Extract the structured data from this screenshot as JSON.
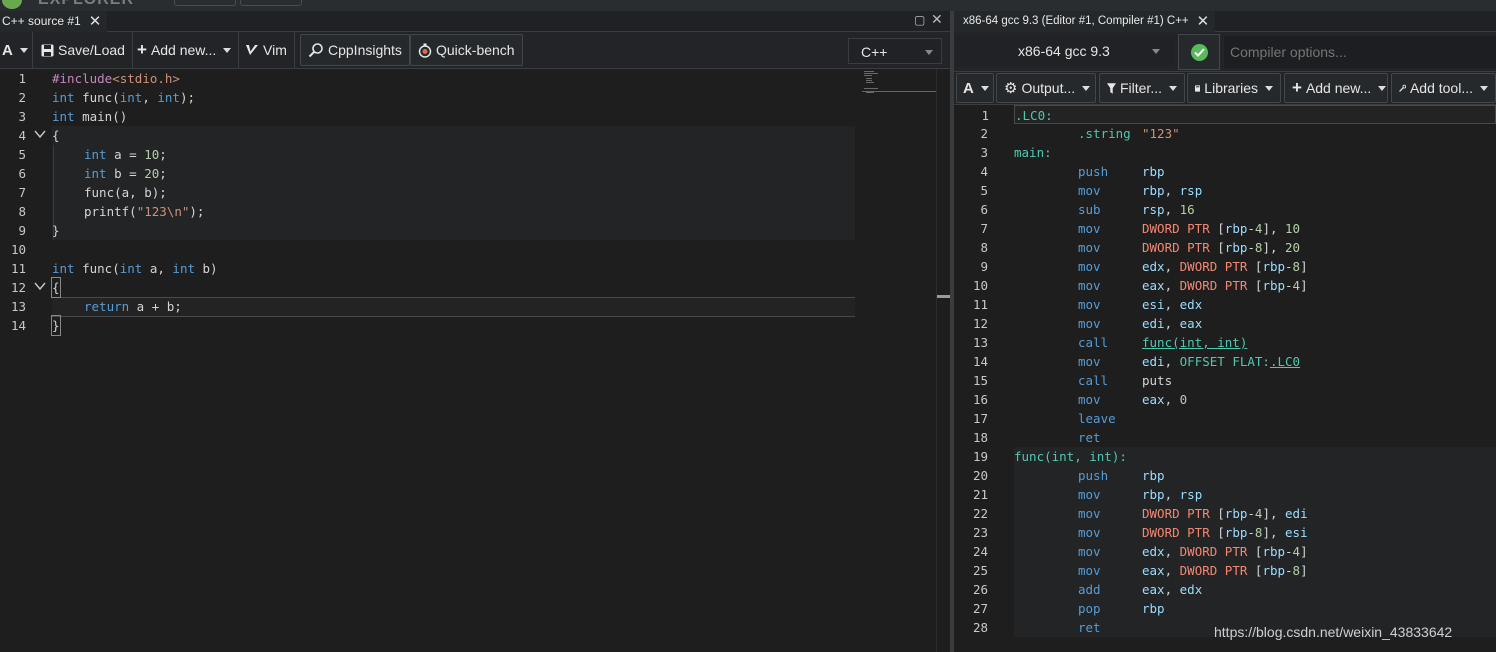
{
  "brand": {
    "logo_text": "EXPLORER"
  },
  "left": {
    "tab_label": "C++ source #1",
    "toolbar": {
      "font_btn": "A",
      "save_load": "Save/Load",
      "add_new": "Add new...",
      "vim": "Vim",
      "cppinsights": "CppInsights",
      "quick_bench": "Quick-bench"
    },
    "language": "C++",
    "code": [
      {
        "n": "1",
        "fold": false
      },
      {
        "n": "2",
        "fold": false
      },
      {
        "n": "3",
        "fold": false
      },
      {
        "n": "4",
        "fold": true
      },
      {
        "n": "5",
        "fold": false
      },
      {
        "n": "6",
        "fold": false
      },
      {
        "n": "7",
        "fold": false
      },
      {
        "n": "8",
        "fold": false
      },
      {
        "n": "9",
        "fold": false
      },
      {
        "n": "10",
        "fold": false
      },
      {
        "n": "11",
        "fold": false
      },
      {
        "n": "12",
        "fold": true
      },
      {
        "n": "13",
        "fold": false
      },
      {
        "n": "14",
        "fold": false
      }
    ],
    "source": {
      "l1a": "#include",
      "l1b": "<stdio.h>",
      "l2a": "int",
      "l2b": " func(",
      "l2c": "int",
      ", ": "",
      "l2d": ", ",
      "l2e": "int",
      "l2f": ");",
      "l3a": "int",
      "l3b": " main()",
      "l4": "{",
      "l5a": "int",
      "l5b": " a = ",
      "l5c": "10",
      "l5d": ";",
      "l6a": "int",
      "l6b": " b = ",
      "l6c": "20",
      "l6d": ";",
      "l7": "func(a, b);",
      "l8a": "printf(",
      "l8b": "\"123\\n\"",
      "l8c": ");",
      "l9": "}",
      "l11a": "int",
      "l11b": " func(",
      "l11c": "int",
      "l11d": " a, ",
      "l11e": "int",
      "l11f": " b)",
      "l12": "{",
      "l13a": "return",
      "l13b": " a + b;",
      "l14": "}"
    }
  },
  "right": {
    "tab_label": "x86-64 gcc 9.3 (Editor #1, Compiler #1) C++",
    "compiler": "x86-64 gcc 9.3",
    "compiler_options_placeholder": "Compiler options...",
    "toolbar": {
      "font_btn": "A",
      "output": "Output...",
      "filter": "Filter...",
      "libraries": "Libraries",
      "add_new": "Add new...",
      "add_tool": "Add tool..."
    },
    "asm": [
      {
        "n": "1",
        "label": ".LC0:"
      },
      {
        "n": "2",
        "ins": ".string",
        "arg": "\"123\""
      },
      {
        "n": "3",
        "label": "main:"
      },
      {
        "n": "4",
        "ins": "push",
        "arg": "rbp"
      },
      {
        "n": "5",
        "ins": "mov",
        "arg": "rbp, rsp"
      },
      {
        "n": "6",
        "ins": "sub",
        "arg": "rsp, 16"
      },
      {
        "n": "7",
        "ins": "mov",
        "arg": "DWORD PTR [rbp-4], 10"
      },
      {
        "n": "8",
        "ins": "mov",
        "arg": "DWORD PTR [rbp-8], 20"
      },
      {
        "n": "9",
        "ins": "mov",
        "arg": "edx, DWORD PTR [rbp-8]"
      },
      {
        "n": "10",
        "ins": "mov",
        "arg": "eax, DWORD PTR [rbp-4]"
      },
      {
        "n": "11",
        "ins": "mov",
        "arg": "esi, edx"
      },
      {
        "n": "12",
        "ins": "mov",
        "arg": "edi, eax"
      },
      {
        "n": "13",
        "ins": "call",
        "arg": "func(int, int)"
      },
      {
        "n": "14",
        "ins": "mov",
        "arg": "edi, OFFSET FLAT:.LC0"
      },
      {
        "n": "15",
        "ins": "call",
        "arg": "puts"
      },
      {
        "n": "16",
        "ins": "mov",
        "arg": "eax, 0"
      },
      {
        "n": "17",
        "ins": "leave",
        "arg": ""
      },
      {
        "n": "18",
        "ins": "ret",
        "arg": ""
      },
      {
        "n": "19",
        "label": "func(int, int):"
      },
      {
        "n": "20",
        "ins": "push",
        "arg": "rbp"
      },
      {
        "n": "21",
        "ins": "mov",
        "arg": "rbp, rsp"
      },
      {
        "n": "22",
        "ins": "mov",
        "arg": "DWORD PTR [rbp-4], edi"
      },
      {
        "n": "23",
        "ins": "mov",
        "arg": "DWORD PTR [rbp-8], esi"
      },
      {
        "n": "24",
        "ins": "mov",
        "arg": "edx, DWORD PTR [rbp-4]"
      },
      {
        "n": "25",
        "ins": "mov",
        "arg": "eax, DWORD PTR [rbp-8]"
      },
      {
        "n": "26",
        "ins": "add",
        "arg": "eax, edx"
      },
      {
        "n": "27",
        "ins": "pop",
        "arg": "rbp"
      },
      {
        "n": "28",
        "ins": "ret",
        "arg": ""
      }
    ]
  },
  "watermark": "https://blog.csdn.net/weixin_43833642",
  "colors": {
    "keyword": "#569cd6",
    "string": "#ce9178",
    "number": "#b5cea8",
    "label": "#4ec9b0",
    "register": "#9cdcfe",
    "ptr": "#f48771",
    "success": "#5cb85c"
  }
}
